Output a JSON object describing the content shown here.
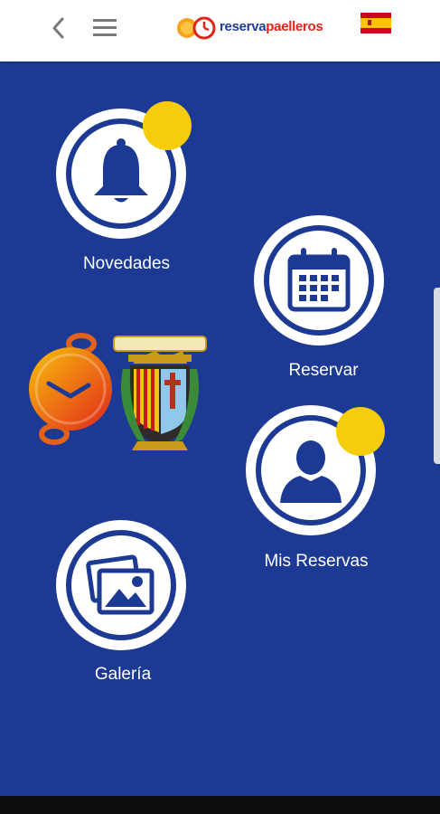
{
  "header": {
    "back_icon": "chevron-left-icon",
    "menu_icon": "hamburger-menu-icon",
    "logo": {
      "text_part1": "reserva",
      "text_part2": "paelleros"
    },
    "language_flag": "spain-flag-icon"
  },
  "menu": {
    "novedades": {
      "label": "Novedades",
      "icon": "bell-icon",
      "has_badge": true
    },
    "reservar": {
      "label": "Reservar",
      "icon": "calendar-icon",
      "has_badge": false
    },
    "mis_reservas": {
      "label": "Mis Reservas",
      "icon": "user-icon",
      "has_badge": true
    },
    "galeria": {
      "label": "Galería",
      "icon": "gallery-icon",
      "has_badge": false
    }
  },
  "colors": {
    "background": "#1c3a93",
    "badge": "#f7cd0b",
    "header": "#ffffff",
    "logo_blue": "#1d3c95",
    "logo_red": "#e2231a"
  }
}
